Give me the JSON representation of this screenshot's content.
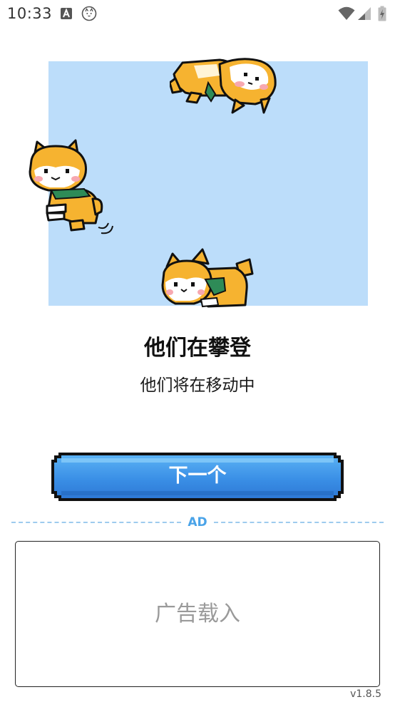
{
  "status_bar": {
    "time": "10:33",
    "left_icons": [
      "a-notification-icon",
      "cat-face-icon"
    ],
    "right_icons": [
      "wifi-icon",
      "cellular-signal-icon",
      "battery-charging-icon"
    ]
  },
  "illustration": {
    "background_color": "#bcddfa",
    "characters": [
      "shiba-dog-climbing-top",
      "shiba-dog-climbing-left",
      "shiba-dog-climbing-bottom"
    ]
  },
  "content": {
    "title": "他们在攀登",
    "subtitle": "他们将在移动中"
  },
  "next_button": {
    "label": "下一个",
    "color": "#3a8fe6"
  },
  "ad": {
    "divider_label": "AD",
    "loading_text": "广告载入"
  },
  "footer": {
    "version": "v1.8.5"
  }
}
